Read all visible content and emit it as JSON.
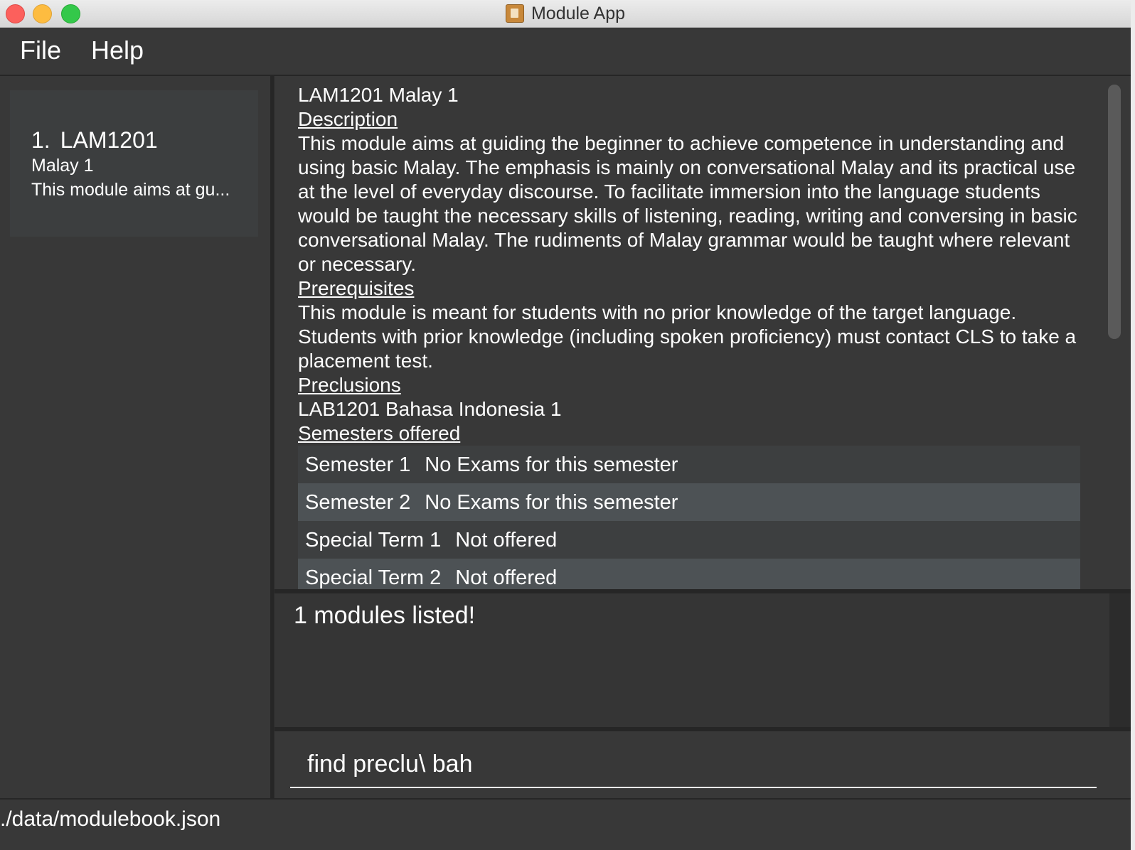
{
  "window": {
    "title": "Module App"
  },
  "menu": {
    "file": "File",
    "help": "Help"
  },
  "module_list": [
    {
      "index": "1.",
      "code": "LAM1201",
      "title": "Malay 1",
      "description_preview": "This module aims at gu..."
    }
  ],
  "detail": {
    "header": "LAM1201 Malay 1",
    "description_heading": "Description",
    "description": "This module aims at guiding the beginner to achieve competence in understanding and using basic Malay. The emphasis is mainly on conversational Malay and its practical use at the level of everyday discourse. To facilitate immersion into the language students would be taught the necessary skills of listening, reading, writing and conversing in basic conversational Malay. The rudiments of Malay grammar would be taught where relevant or necessary.",
    "prerequisites_heading": "Prerequisites",
    "prerequisites": "This module is meant for students with no prior knowledge of the target language. Students with prior knowledge (including spoken proficiency) must contact CLS to take a placement test.",
    "preclusions_heading": "Preclusions",
    "preclusions": "LAB1201 Bahasa Indonesia 1",
    "semesters_heading": "Semesters offered",
    "semesters": [
      {
        "name": "Semester 1",
        "info": "No Exams for this semester"
      },
      {
        "name": "Semester 2",
        "info": "No Exams for this semester"
      },
      {
        "name": "Special Term 1",
        "info": "Not offered"
      },
      {
        "name": "Special Term 2",
        "info": "Not offered"
      }
    ]
  },
  "result": {
    "message": "1 modules listed!"
  },
  "command": {
    "value": "find preclu\\ bah"
  },
  "status": {
    "file_path": "./data/modulebook.json"
  }
}
